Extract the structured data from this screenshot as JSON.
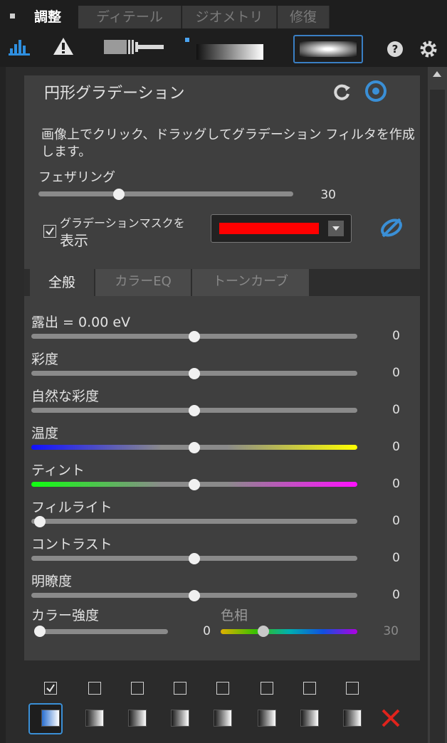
{
  "tabs": [
    "調整",
    "ディテール",
    "ジオメトリ",
    "修復"
  ],
  "panel": {
    "title": "円形グラデーション",
    "description": "画像上でクリック、ドラッグしてグラデーション フィルタを作成します。",
    "feather": {
      "label": "フェザリング",
      "value": "30",
      "fraction": 0.31
    },
    "show_mask": {
      "label_line1": "グラデーションマスクを",
      "label_line2": "表示",
      "checked": true
    },
    "mask_color": "#ff0000",
    "subtabs": [
      "全般",
      "カラーEQ",
      "トーンカーブ"
    ],
    "sliders": [
      {
        "label": "露出 = 0.00 eV",
        "value": "0",
        "fraction": 0.5
      },
      {
        "label": "彩度",
        "value": "0",
        "fraction": 0.5
      },
      {
        "label": "自然な彩度",
        "value": "0",
        "fraction": 0.5
      },
      {
        "label": "温度",
        "value": "0",
        "fraction": 0.5
      },
      {
        "label": "ティント",
        "value": "0",
        "fraction": 0.5
      },
      {
        "label": "フィルライト",
        "value": "0",
        "fraction": 0.0
      },
      {
        "label": "コントラスト",
        "value": "0",
        "fraction": 0.5
      },
      {
        "label": "明瞭度",
        "value": "0",
        "fraction": 0.5
      }
    ],
    "color_strength": {
      "label": "カラー強度",
      "value": "0",
      "fraction": 0.0
    },
    "hue": {
      "label": "色相",
      "value": "30",
      "fraction": 0.3
    }
  },
  "presets": {
    "checked": [
      true,
      false,
      false,
      false,
      false,
      false,
      false,
      false
    ]
  },
  "colors": {
    "accent": "#3a8fd6",
    "delete": "#e0231c"
  }
}
